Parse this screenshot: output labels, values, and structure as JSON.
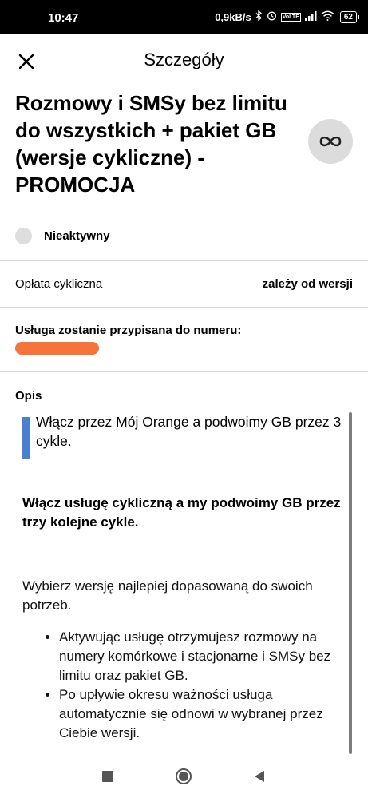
{
  "status_bar": {
    "time": "10:47",
    "network_speed": "0,9kB/s",
    "volte": "VoLTE",
    "battery": "62",
    "icons": [
      "bluetooth-icon",
      "alarm-icon",
      "volte-icon",
      "signal-icon",
      "wifi-icon",
      "battery-icon"
    ]
  },
  "header": {
    "title": "Szczegóły",
    "close_icon": "close-icon"
  },
  "service": {
    "title": "Rozmowy i SMSy bez limitu do wszystkich + pakiet GB (wersje cykliczne) - PROMOCJA",
    "badge_icon": "infinity-icon"
  },
  "status": {
    "label": "Nieaktywny"
  },
  "fee": {
    "label": "Opłata cykliczna",
    "value": "zależy od wersji"
  },
  "assignment": {
    "label": "Usługa zostanie przypisana do numeru:"
  },
  "description": {
    "label": "Opis",
    "callout": "Włącz przez Mój Orange a podwoimy GB przez 3 cykle.",
    "bold_paragraph": "Włącz usługę cykliczną a my podwoimy GB przez trzy kolejne cykle.",
    "paragraph": "Wybierz wersję najlepiej dopasowaną do swoich potrzeb.",
    "bullets": [
      "Aktywując usługę otrzymujesz rozmowy na numery komórkowe i stacjonarne i SMSy bez limitu oraz pakiet GB.",
      "Po upływie okresu ważności usługa automatycznie się odnowi w wybranej przez Ciebie wersji."
    ]
  },
  "colors": {
    "accent_bar": "#4a7fd4",
    "redaction": "#f4743a",
    "status_dot": "#dedede"
  },
  "navbar": {
    "icons": [
      "recents-icon",
      "home-icon",
      "back-icon"
    ]
  }
}
